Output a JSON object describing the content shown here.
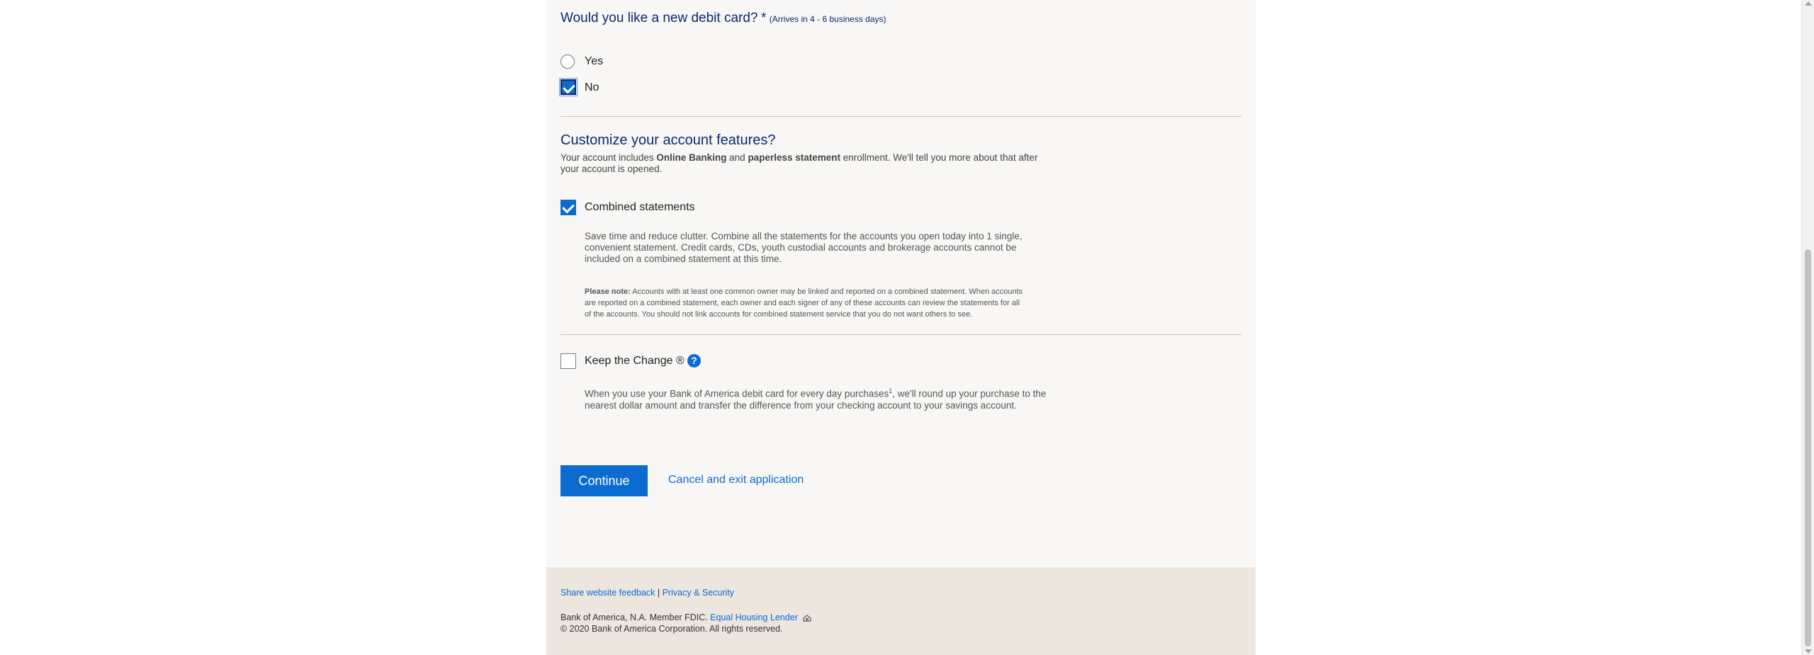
{
  "debit_card": {
    "question": "Would you like a new debit card?",
    "required_mark": "*",
    "arrival_note": "(Arrives in 4 - 6 business days)",
    "options": [
      {
        "label": "Yes",
        "selected": false
      },
      {
        "label": "No",
        "selected": true
      }
    ]
  },
  "features": {
    "title": "Customize your account features?",
    "intro_prefix": "Your account includes",
    "intro_online_banking": "Online Banking",
    "intro_and": "and",
    "intro_paperless": "paperless statement",
    "intro_suffix_line1": "enrollment. We'll tell you more about that after",
    "intro_suffix_line2": "your account is opened.",
    "combined": {
      "label": "Combined statements",
      "checked": true,
      "desc_line1": "Save time and reduce clutter. Combine all the statements for the accounts you open today into 1 single,",
      "desc_line2": "convenient statement. Credit cards, CDs, youth custodial accounts and brokerage accounts cannot be",
      "desc_line3": "included on a combined statement at this time.",
      "note_label": "Please note:",
      "note_line1": "Accounts with at least one common owner may be linked and reported on a combined statement. When accounts",
      "note_line2": "are reported on a combined statement, each owner and each signer of any of these accounts can review the statements for all",
      "note_line3": "of the accounts. You should not link accounts for combined statement service that you do not want others to see."
    },
    "keep_change": {
      "label": "Keep the Change ®",
      "checked": false,
      "help_icon_text": "?",
      "desc_line1_a": "When you use your Bank of America debit card for every day purchases",
      "desc_sup": "1",
      "desc_line1_b": ", we'll round up your purchase to the",
      "desc_line2": "nearest dollar amount and transfer the difference from your checking account to your savings account."
    }
  },
  "actions": {
    "continue_label": "Continue",
    "cancel_label": "Cancel and exit application"
  },
  "footer": {
    "feedback_link": "Share website feedback",
    "separator": "|",
    "privacy_link": "Privacy & Security",
    "fdic_text": "Bank of America, N.A. Member FDIC.",
    "equal_housing_link": "Equal Housing Lender",
    "copyright": "© 2020 Bank of America Corporation. All rights reserved."
  },
  "colors": {
    "accent_blue": "#0b6bd0",
    "heading_navy": "#0a2a6b",
    "panel_bg": "#f8f7f5",
    "footer_bg": "#ece6df"
  },
  "icons": [
    "checkmark-icon",
    "help-icon",
    "equal-housing-icon"
  ]
}
